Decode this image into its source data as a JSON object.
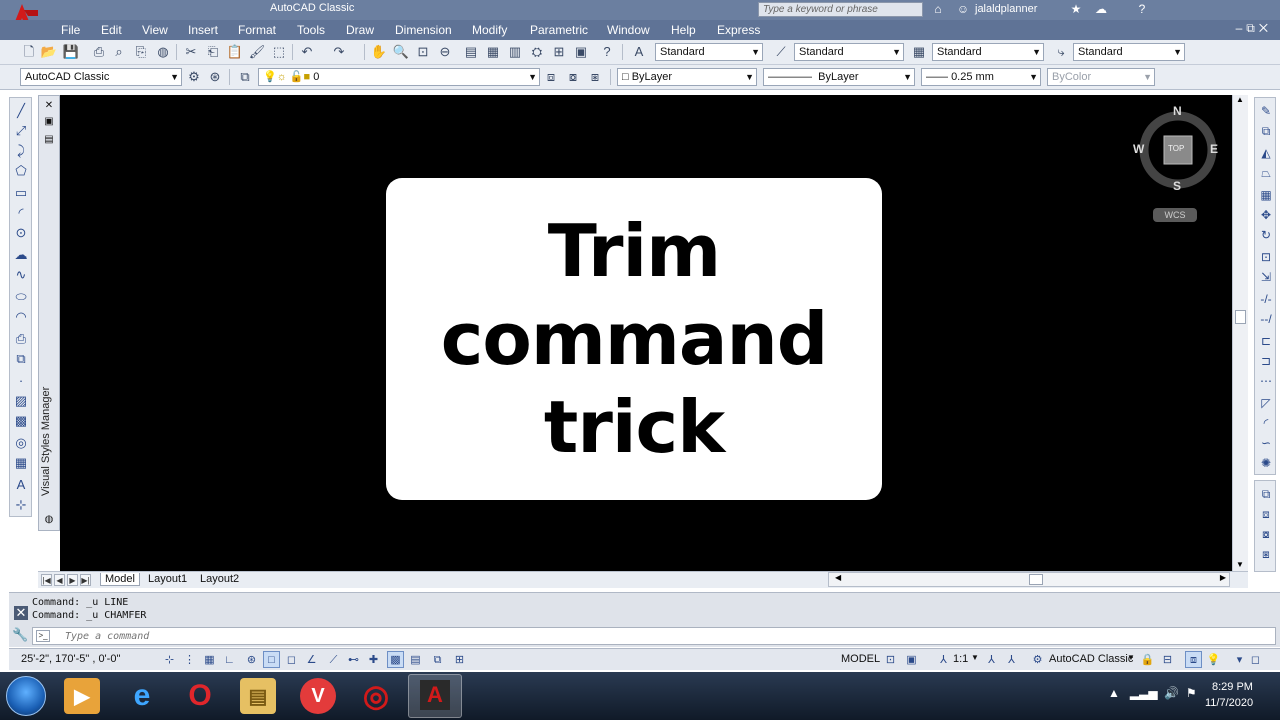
{
  "window": {
    "title": "AutoCAD Classic",
    "search_placeholder": "Type a keyword or phrase",
    "user": "jalaldplanner"
  },
  "menu": [
    "File",
    "Edit",
    "View",
    "Insert",
    "Format",
    "Tools",
    "Draw",
    "Dimension",
    "Modify",
    "Parametric",
    "Window",
    "Help",
    "Express"
  ],
  "toolbar1": {
    "text_style": "Standard",
    "dim_style": "Standard",
    "table_style": "Standard",
    "mleader_style": "Standard"
  },
  "toolbar2": {
    "workspace": "AutoCAD Classic",
    "layer": "0",
    "color": "ByLayer",
    "linetype": "ByLayer",
    "lineweight": "0.25 mm",
    "plotstyle": "ByColor"
  },
  "palette": {
    "vsm_label": "Visual Styles Manager"
  },
  "viewcube": {
    "north": "N",
    "south": "S",
    "east": "E",
    "west": "W",
    "face": "TOP",
    "wcs": "WCS"
  },
  "overlay": {
    "line1": "Trim",
    "line2": "command",
    "line3": "trick"
  },
  "tabs": [
    "Model",
    "Layout1",
    "Layout2"
  ],
  "command": {
    "history": [
      "Command: _u LINE",
      "Command: _u CHAMFER"
    ],
    "placeholder": "Type a command"
  },
  "status": {
    "coords": "25'-2\", 170'-5\" , 0'-0\"",
    "model": "MODEL",
    "scale": "1:1",
    "workspace": "AutoCAD Classic"
  },
  "taskbar": {
    "time": "8:29 PM",
    "date": "11/7/2020"
  }
}
